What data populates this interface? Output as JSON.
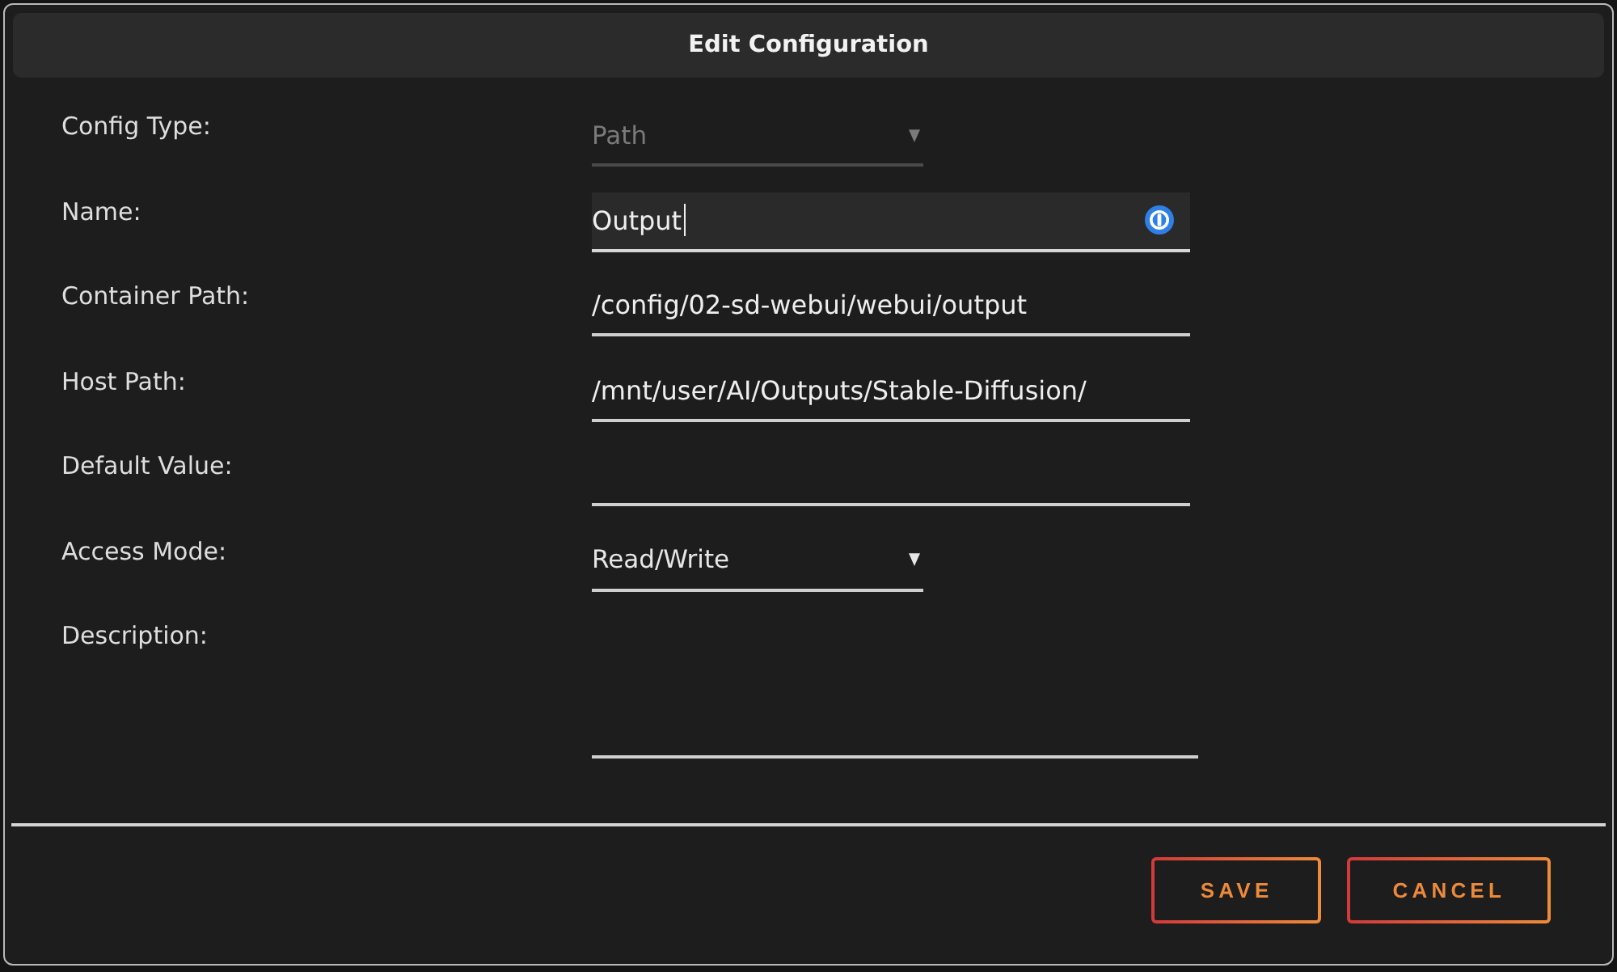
{
  "dialog": {
    "title": "Edit Configuration"
  },
  "fields": [
    {
      "label": "Config Type:",
      "kind": "select",
      "value": "Path",
      "disabled": true
    },
    {
      "label": "Name:",
      "kind": "text",
      "value": "Output",
      "focused": true
    },
    {
      "label": "Container Path:",
      "kind": "text",
      "value": "/config/02-sd-webui/webui/output",
      "focused": false
    },
    {
      "label": "Host Path:",
      "kind": "text",
      "value": "/mnt/user/AI/Outputs/Stable-Diffusion/",
      "focused": false
    },
    {
      "label": "Default Value:",
      "kind": "text",
      "focused": false
    },
    {
      "label": "Access Mode:",
      "kind": "select",
      "value": "Read/Write",
      "disabled": false
    },
    {
      "label": "Description:",
      "kind": "textarea"
    }
  ],
  "buttons": [
    {
      "label": "SAVE"
    },
    {
      "label": "CANCEL"
    }
  ]
}
